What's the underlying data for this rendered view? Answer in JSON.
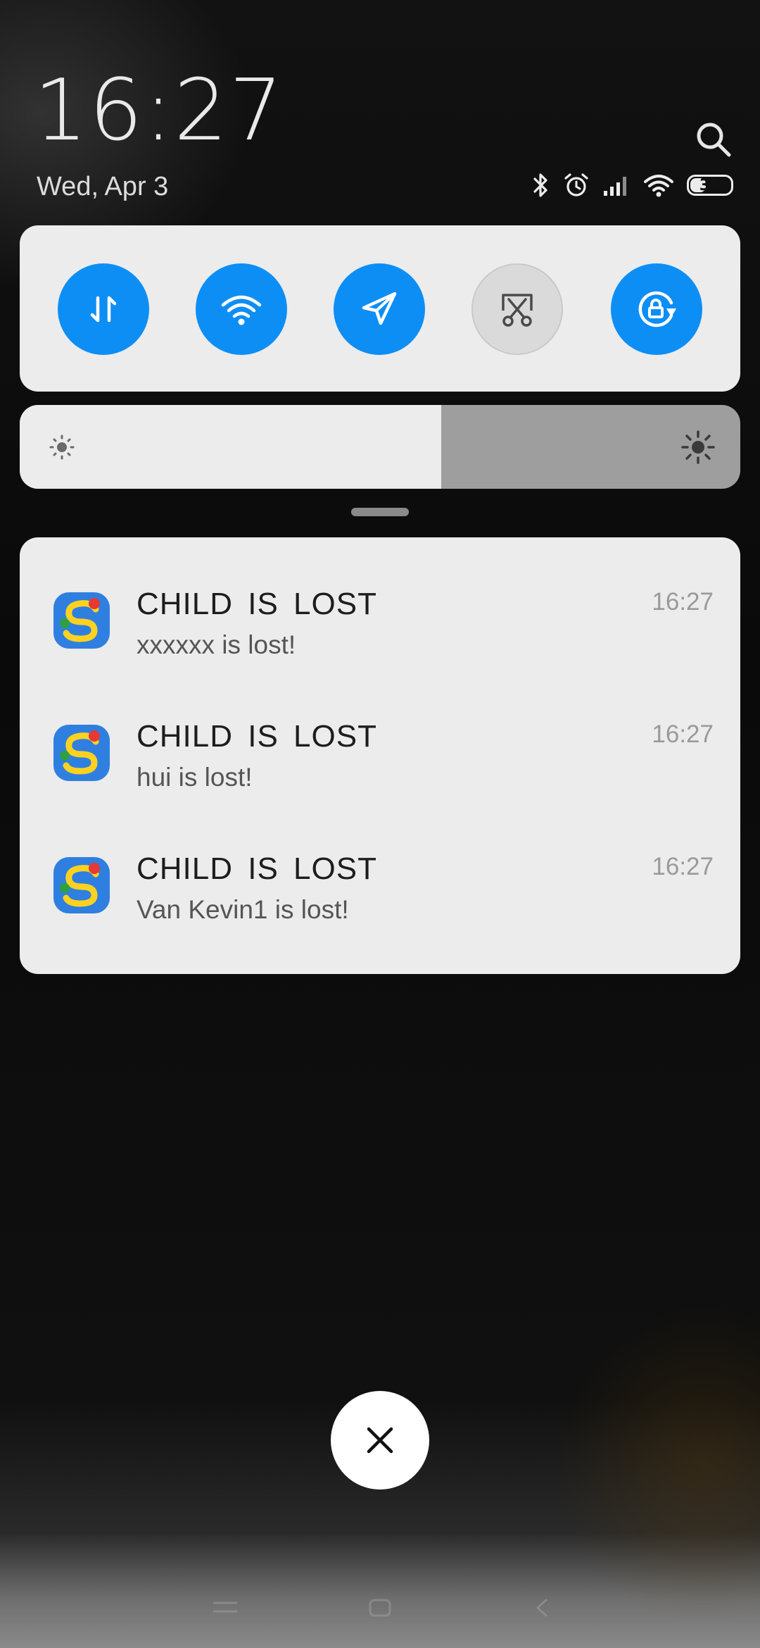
{
  "header": {
    "time": "16:27",
    "date": "Wed, Apr 3"
  },
  "status": {
    "battery_level": "36",
    "icons": [
      "bluetooth-icon",
      "alarm-icon",
      "signal-icon",
      "wifi-icon",
      "battery-icon"
    ]
  },
  "quick_toggles": [
    {
      "name": "mobile-data",
      "icon": "data-transfer-icon",
      "state": "on"
    },
    {
      "name": "wifi",
      "icon": "wifi-icon",
      "state": "on"
    },
    {
      "name": "location",
      "icon": "location-arrow-icon",
      "state": "on"
    },
    {
      "name": "screenshot",
      "icon": "scissors-icon",
      "state": "off"
    },
    {
      "name": "rotation-lock",
      "icon": "rotation-lock-icon",
      "state": "on"
    }
  ],
  "brightness": {
    "level": 0.585
  },
  "notifications": [
    {
      "title": "CHILD IS LOST",
      "body": "xxxxxx is lost!",
      "time": "16:27"
    },
    {
      "title": "CHILD IS LOST",
      "body": "hui is lost!",
      "time": "16:27"
    },
    {
      "title": "CHILD IS LOST",
      "body": "Van Kevin1 is lost!",
      "time": "16:27"
    }
  ],
  "colors": {
    "accent": "#0d8ef5",
    "panel": "#ececec",
    "background": "#0d0d0d"
  }
}
